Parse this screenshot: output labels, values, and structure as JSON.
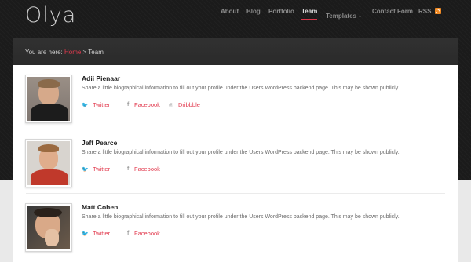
{
  "site": {
    "logo": "Olya"
  },
  "nav": {
    "items": [
      {
        "label": "About"
      },
      {
        "label": "Blog"
      },
      {
        "label": "Portfolio"
      },
      {
        "label": "Team"
      },
      {
        "label": "Templates"
      },
      {
        "label": "Contact Form"
      },
      {
        "label": "RSS"
      }
    ],
    "active": "Team",
    "templates_caret": "▾"
  },
  "breadcrumb": {
    "prefix": "You are here: ",
    "home": "Home",
    "separator": " > ",
    "current": "Team"
  },
  "bio_text": "Share a little biographical information to fill out your profile under the Users WordPress backend page. This may be shown publicly.",
  "members": [
    {
      "name": "Adii Pienaar",
      "links": [
        "Twitter",
        "Facebook",
        "Dribbble"
      ]
    },
    {
      "name": "Jeff Pearce",
      "links": [
        "Twitter",
        "Facebook"
      ]
    },
    {
      "name": "Matt Cohen",
      "links": [
        "Twitter",
        "Facebook"
      ]
    }
  ],
  "icons": {
    "twitter": "twitter-bird-icon",
    "facebook": "facebook-f-icon",
    "dribbble": "dribbble-ball-icon",
    "rss": "rss-feed-icon"
  },
  "colors": {
    "accent": "#e23a4e",
    "nav_active_underline": "#d8374a",
    "rss": "#f08a24"
  }
}
